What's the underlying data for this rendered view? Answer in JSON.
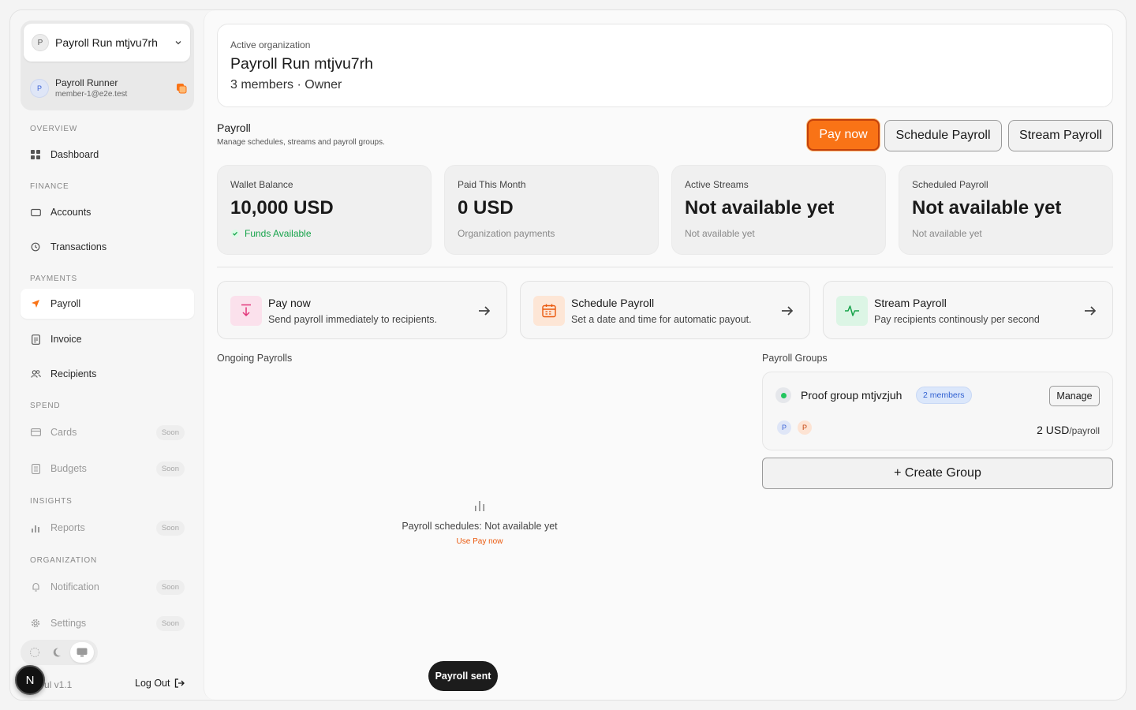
{
  "sidebar": {
    "org_name": "Payroll Run mtjvu7rh",
    "org_initial": "P",
    "user": {
      "name": "Payroll Runner",
      "email": "member-1@e2e.test",
      "initial": "P"
    },
    "sections": {
      "overview": "OVERVIEW",
      "finance": "FINANCE",
      "payments": "PAYMENTS",
      "spend": "SPEND",
      "insights": "INSIGHTS",
      "organization": "ORGANIZATION"
    },
    "items": {
      "dashboard": "Dashboard",
      "accounts": "Accounts",
      "transactions": "Transactions",
      "payroll": "Payroll",
      "invoice": "Invoice",
      "recipients": "Recipients",
      "cards": "Cards",
      "budgets": "Budgets",
      "reports": "Reports",
      "notification": "Notification",
      "settings": "Settings"
    },
    "soon": "Soon",
    "version": "ul v1.1",
    "logout": "Log Out",
    "badge": "N"
  },
  "header": {
    "label": "Active organization",
    "name": "Payroll Run mtjvu7rh",
    "meta": "3 members · Owner"
  },
  "payroll": {
    "title": "Payroll",
    "subtitle": "Manage schedules, streams and payroll groups.",
    "buttons": {
      "pay_now": "Pay now",
      "schedule": "Schedule Payroll",
      "stream": "Stream Payroll"
    }
  },
  "stats": [
    {
      "title": "Wallet Balance",
      "value": "10,000 USD",
      "sub": "Funds Available"
    },
    {
      "title": "Paid This Month",
      "value": "0 USD",
      "sub": "Organization payments"
    },
    {
      "title": "Active Streams",
      "value": "Not available yet",
      "sub": "Not available yet"
    },
    {
      "title": "Scheduled Payroll",
      "value": "Not available yet",
      "sub": "Not available yet"
    }
  ],
  "actions": [
    {
      "title": "Pay now",
      "desc": "Send payroll immediately to recipients."
    },
    {
      "title": "Schedule Payroll",
      "desc": "Set a date and time for automatic payout."
    },
    {
      "title": "Stream Payroll",
      "desc": "Pay recipients continously per second"
    }
  ],
  "ongoing": {
    "title": "Ongoing Payrolls",
    "empty_text": "Payroll schedules: Not available yet",
    "empty_link": "Use Pay now"
  },
  "groups": {
    "title": "Payroll Groups",
    "items": [
      {
        "name": "Proof group mtjvzjuh",
        "badge": "2 members",
        "manage": "Manage",
        "avatars": [
          "P",
          "P"
        ],
        "amount": "2 USD",
        "unit": "/payroll"
      }
    ],
    "create": "+ Create Group"
  },
  "toast": "Payroll sent",
  "colors": {
    "accent": "#f97316",
    "success": "#16a34a",
    "badge_blue": "#2f5fd0"
  }
}
